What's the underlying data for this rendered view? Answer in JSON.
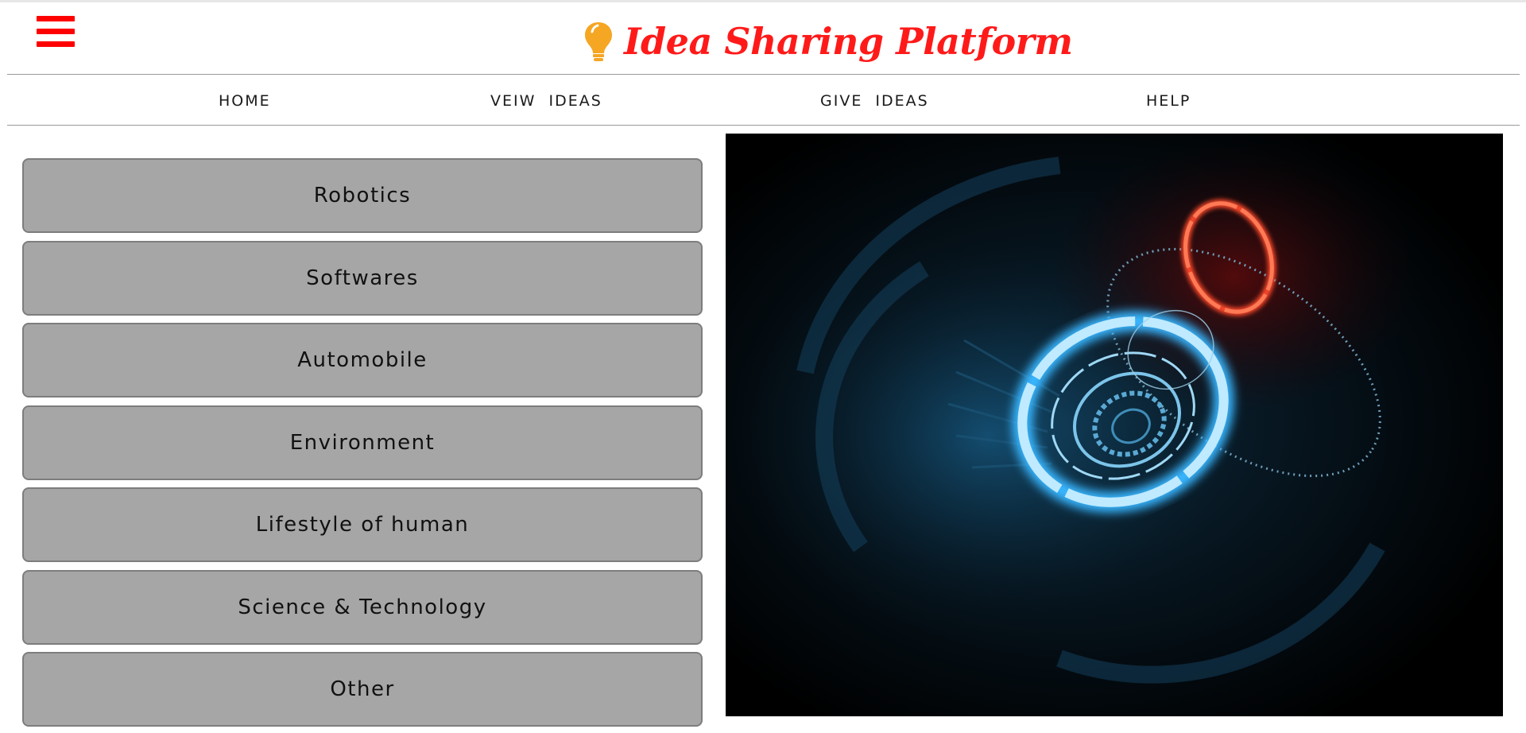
{
  "header": {
    "menu_icon": "hamburger-menu-icon",
    "logo_icon": "lightbulb-icon",
    "title": "Idea Sharing Platform"
  },
  "colors": {
    "brand": "#ff1a1a",
    "bulb": "#f5a623",
    "button_bg": "#a6a6a6",
    "button_border": "#7d7d7d"
  },
  "nav": {
    "items": [
      {
        "label": "HOME"
      },
      {
        "label": "VEIW  IDEAS"
      },
      {
        "label": "GIVE  IDEAS"
      },
      {
        "label": "HELP"
      }
    ]
  },
  "categories": [
    {
      "label": "Robotics"
    },
    {
      "label": "Softwares"
    },
    {
      "label": "Automobile"
    },
    {
      "label": "Environment"
    },
    {
      "label": "Lifestyle of human"
    },
    {
      "label": "Science & Technology"
    },
    {
      "label": "Other"
    }
  ],
  "hero": {
    "image": "futuristic-tech-rings-image"
  }
}
